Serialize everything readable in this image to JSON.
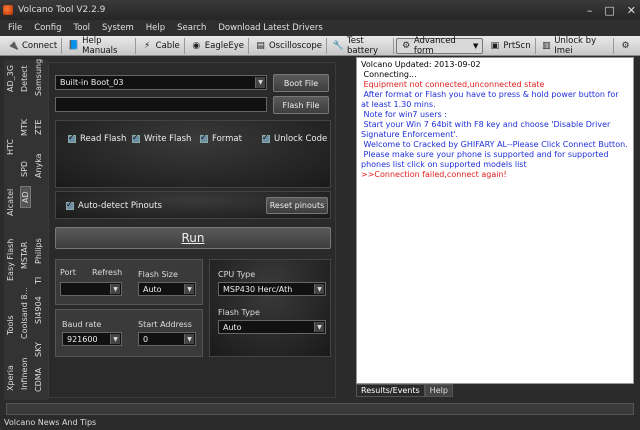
{
  "window": {
    "title": "Volcano Tool V2.2.9"
  },
  "menu": [
    "File",
    "Config",
    "Tool",
    "System",
    "Help",
    "Search",
    "Download Latest Drivers"
  ],
  "toolbar": {
    "connect": "Connect",
    "help_manuals": "Help Manuals",
    "cable": "Cable",
    "eagleeye": "EagleEye",
    "oscilloscope": "Oscilloscope",
    "test_battery": "Test battery",
    "advanced_form": "Advanced form",
    "prtscn": "PrtScn",
    "unlock_imei": "Unlock by Imei"
  },
  "side_tabs": [
    "AD_3G",
    "Detect",
    "Samsung",
    "MTK",
    "ZTE",
    "HTC",
    "SPD",
    "Anyka",
    "Alcatel",
    "AD",
    "MSTAR",
    "Philips",
    "Easy Flash",
    "TI",
    "Tools",
    "Coolsand 8...",
    "SI4904",
    "Xperia",
    "Infineon",
    "SKY",
    "CDMA"
  ],
  "main": {
    "boot_select": "Built-in Boot_03",
    "boot_file_button": "Boot File",
    "flash_file_value": "",
    "flash_file_button": "Flash File",
    "checks": {
      "read_flash": "Read Flash",
      "write_flash": "Write Flash",
      "format": "Format",
      "unlock_code": "Unlock Code"
    },
    "auto_detect": "Auto-detect Pinouts",
    "reset_pinouts": "Reset pinouts",
    "run": "Run",
    "port_label": "Port",
    "refresh_label": "Refresh",
    "port_value": "",
    "flash_size_label": "Flash Size",
    "flash_size_value": "Auto",
    "baud_rate_label": "Baud rate",
    "baud_rate_value": "921600",
    "start_address_label": "Start Address",
    "start_address_value": "0",
    "cpu_type_label": "CPU Type",
    "cpu_type_value": "MSP430 Herc/Ath",
    "flash_type_label": "Flash Type",
    "flash_type_value": "Auto"
  },
  "log": {
    "lines": [
      {
        "text": "Volcano Updated: 2013-09-02",
        "color": "#000000"
      },
      {
        "text": " Connecting...",
        "color": "#000000"
      },
      {
        "text": " Equipment not connected,unconnected state",
        "color": "#e0201e"
      },
      {
        "text": " After format or Flash you have to press & hold power button for at least 1.30 mins.",
        "color": "#1f2fd8"
      },
      {
        "text": " Note for win7 users :",
        "color": "#1f2fd8"
      },
      {
        "text": " Start your Win 7 64bit with F8 key and choose 'Disable Driver Signature Enforcement'.",
        "color": "#1f2fd8"
      },
      {
        "text": " Welcome to Cracked by GHIFARY AL--Please Click Connect Button.",
        "color": "#1f2fd8"
      },
      {
        "text": " Please make sure your phone is supported and for supported phones list click on supported models list",
        "color": "#1f2fd8"
      },
      {
        "text": ">>Connection failed,connect again!",
        "color": "#e0201e"
      }
    ],
    "tabs": [
      "Results/Events",
      "Help"
    ]
  },
  "status": {
    "news": "Volcano News And Tips"
  }
}
